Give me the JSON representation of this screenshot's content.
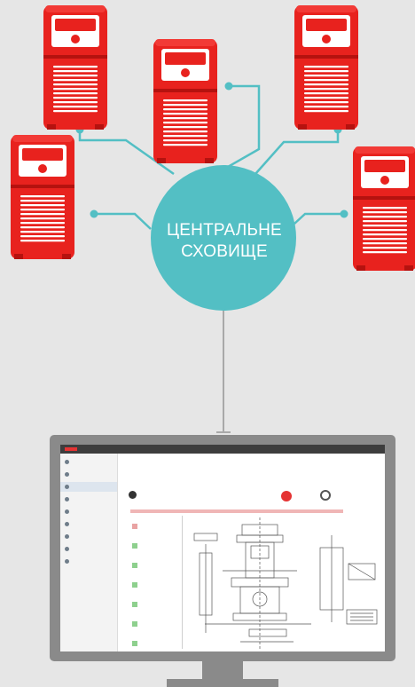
{
  "hub": {
    "label_line1": "ЦЕНТРАЛЬНЕ",
    "label_line2": "СХОВИЩЕ",
    "color": "#53bfc4"
  },
  "colors": {
    "machine": "#e8221e",
    "machine_dark": "#b5120f",
    "connector": "#53bfc4",
    "cable": "#a9a9a9",
    "monitor": "#8a8a8a"
  },
  "icons": {
    "machine": "welding-machine-icon",
    "monitor": "monitor-icon"
  }
}
